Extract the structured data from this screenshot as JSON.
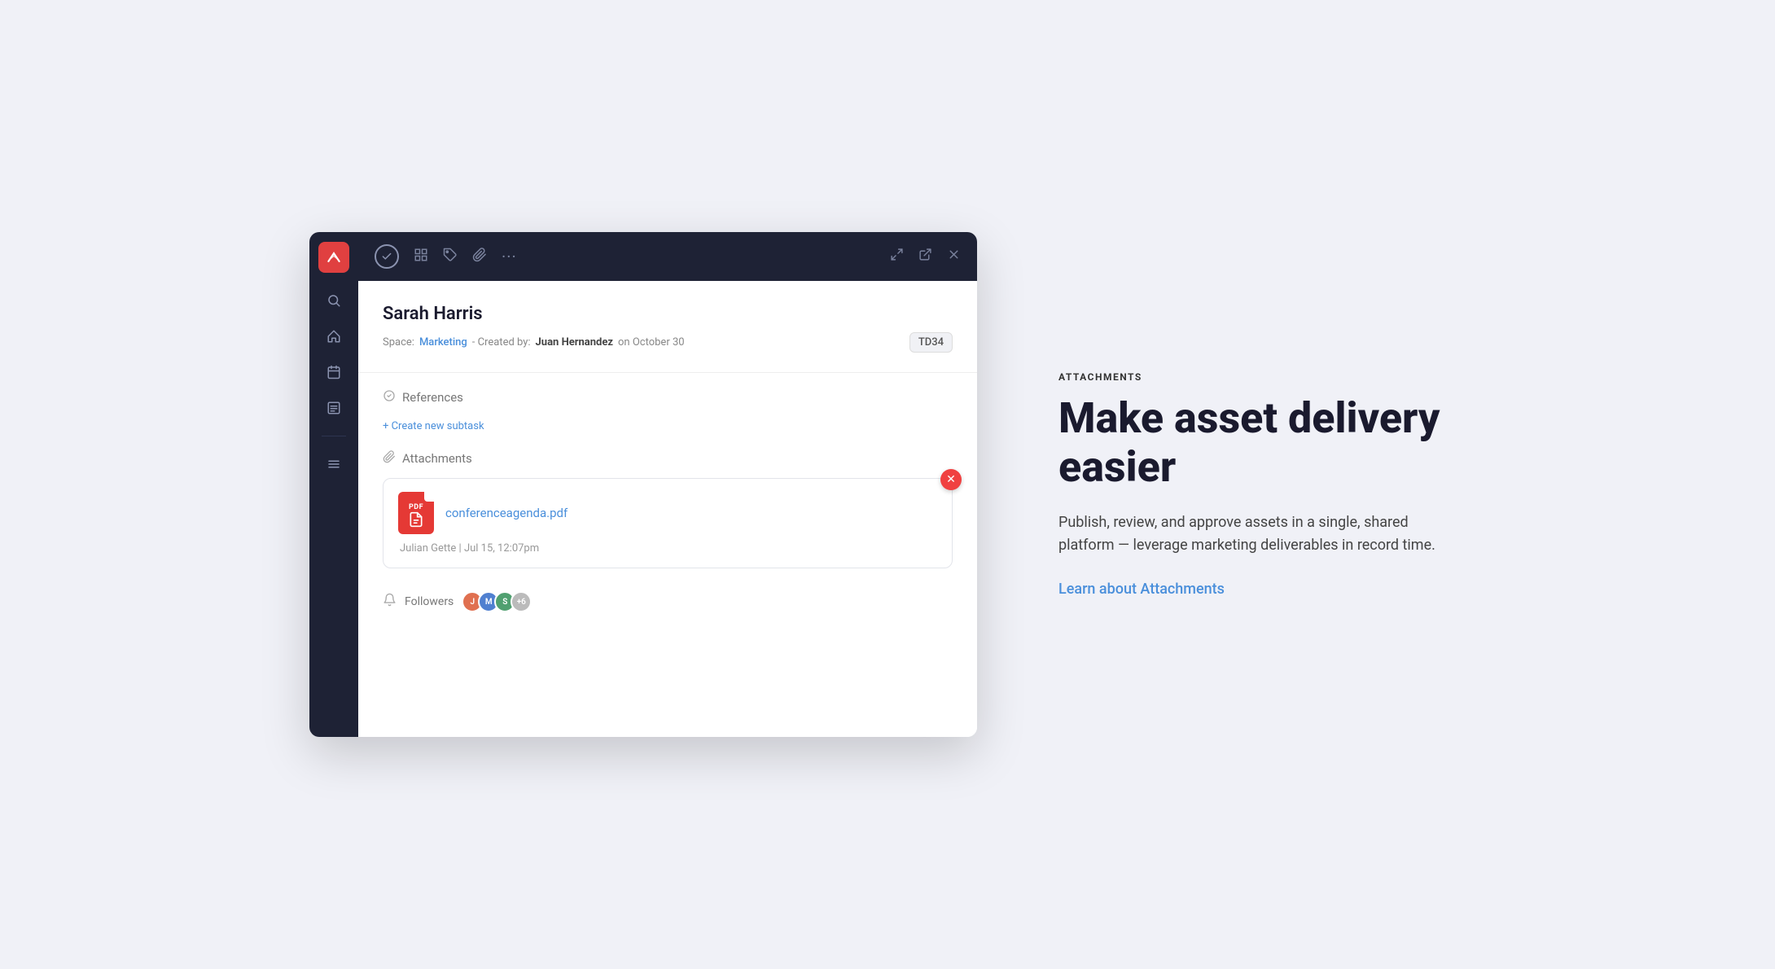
{
  "sidebar": {
    "logo_alt": "ClickUp Logo",
    "icons": [
      {
        "name": "search-icon",
        "symbol": "🔍"
      },
      {
        "name": "home-icon",
        "symbol": "🏠"
      },
      {
        "name": "calendar-icon",
        "symbol": "📅"
      },
      {
        "name": "tasks-icon",
        "symbol": "📋"
      },
      {
        "name": "menu-icon",
        "symbol": "☰"
      }
    ]
  },
  "toolbar": {
    "check_label": "✓",
    "grid_icon": "⊞",
    "tag_icon": "⬡",
    "attach_icon": "📎",
    "more_icon": "···",
    "expand_icon": "⤢",
    "external_icon": "⬜",
    "close_icon": "✕"
  },
  "task": {
    "title": "Sarah Harris",
    "meta_space_label": "Space:",
    "meta_space_value": "Marketing",
    "meta_separator": "- Created by:",
    "meta_creator": "Juan Hernandez",
    "meta_date": "on October 30",
    "task_id": "TD34",
    "references_label": "References",
    "create_subtask_label": "+ Create new subtask",
    "attachments_label": "Attachments",
    "attachment": {
      "filename": "conferenceagenda.pdf",
      "uploader": "Julian Gette",
      "timestamp": "Jul 15, 12:07pm"
    },
    "followers_label": "Followers",
    "follower_count": "+6"
  },
  "right_panel": {
    "feature_label": "ATTACHMENTS",
    "headline_line1": "Make asset delivery",
    "headline_line2": "easier",
    "description": "Publish, review, and approve assets in a single, shared platform — leverage marketing deliverables in record time.",
    "learn_link": "Learn about Attachments"
  },
  "colors": {
    "accent_blue": "#4a8fdb",
    "sidebar_bg": "#1e2235",
    "red": "#e04040",
    "close_red": "#f04040"
  }
}
